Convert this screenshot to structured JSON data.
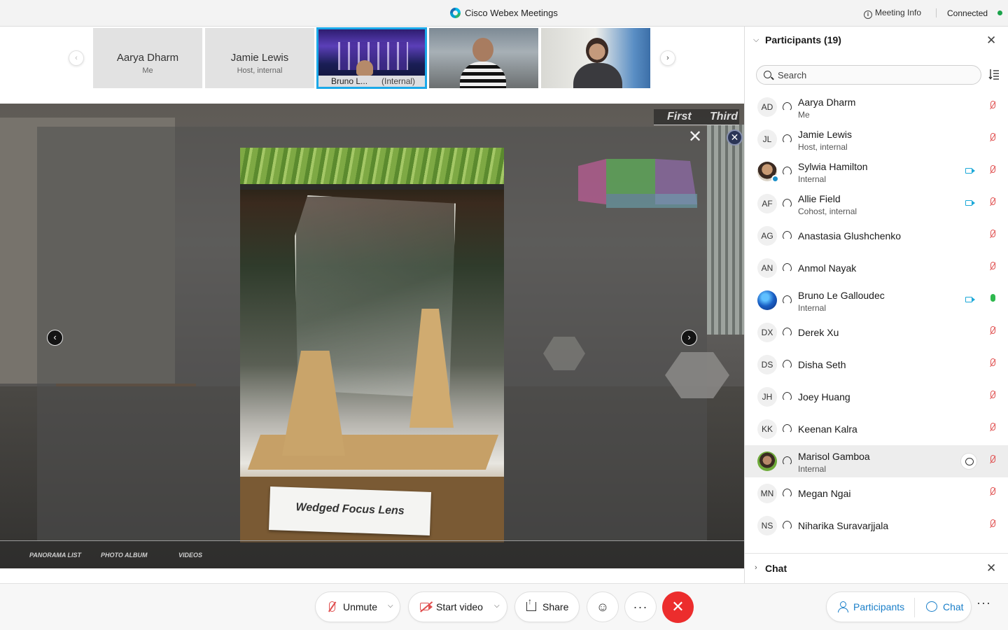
{
  "titlebar": {
    "app_title": "Cisco Webex Meetings",
    "meeting_info": "Meeting Info",
    "status": "Connected",
    "status_color": "#1aa34a"
  },
  "filmstrip": {
    "tiles": [
      {
        "name": "Aarya Dharm",
        "sub": "Me"
      },
      {
        "name": "Jamie Lewis",
        "sub": "Host, internal"
      },
      {
        "name": "Bruno L...",
        "sub": "(Internal)"
      }
    ]
  },
  "stage": {
    "view_tabs": [
      "First",
      "Third"
    ],
    "photo_caption": "Wedged Focus Lens",
    "bottom_links": [
      "PANORAMA LIST",
      "PHOTO ALBUM",
      "VIDEOS"
    ]
  },
  "panel": {
    "title": "Participants (19)",
    "search_placeholder": "Search",
    "participants": [
      {
        "initials": "AD",
        "name": "Aarya Dharm",
        "sub": "Me"
      },
      {
        "initials": "JL",
        "name": "Jamie Lewis",
        "sub": "Host, internal"
      },
      {
        "initials": "",
        "name": "Sylwia Hamilton",
        "sub": "Internal"
      },
      {
        "initials": "AF",
        "name": "Allie Field",
        "sub": "Cohost, internal"
      },
      {
        "initials": "AG",
        "name": "Anastasia Glushchenko",
        "sub": ""
      },
      {
        "initials": "AN",
        "name": "Anmol Nayak",
        "sub": ""
      },
      {
        "initials": "",
        "name": "Bruno Le Galloudec",
        "sub": "Internal"
      },
      {
        "initials": "DX",
        "name": "Derek Xu",
        "sub": ""
      },
      {
        "initials": "DS",
        "name": "Disha Seth",
        "sub": ""
      },
      {
        "initials": "JH",
        "name": "Joey Huang",
        "sub": ""
      },
      {
        "initials": "KK",
        "name": "Keenan Kalra",
        "sub": ""
      },
      {
        "initials": "",
        "name": "Marisol Gamboa",
        "sub": "Internal"
      },
      {
        "initials": "MN",
        "name": "Megan Ngai",
        "sub": ""
      },
      {
        "initials": "NS",
        "name": "Niharika Suravarjjala",
        "sub": ""
      }
    ],
    "chat_title": "Chat"
  },
  "toolbar": {
    "unmute": "Unmute",
    "start_video": "Start video",
    "share": "Share",
    "participants": "Participants",
    "chat": "Chat",
    "accent_color": "#1a7fc9",
    "end_color": "#ec2d2d"
  }
}
